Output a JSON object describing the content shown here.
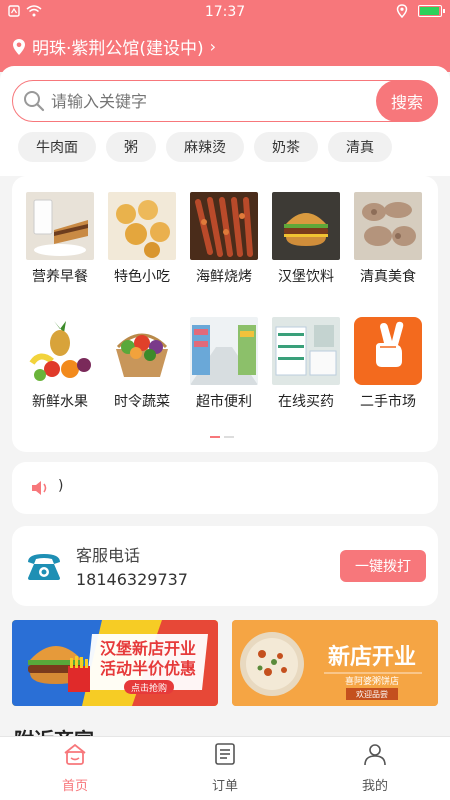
{
  "status_bar": {
    "time": "17:37",
    "battery_level": 0.85,
    "icons": [
      "sim-icon",
      "wifi-icon",
      "location-icon",
      "battery-icon"
    ]
  },
  "header": {
    "location": "明珠·紫荆公馆(建设中)",
    "chevron": "›"
  },
  "search": {
    "placeholder": "请输入关键字",
    "button": "搜索"
  },
  "tags": [
    "牛肉面",
    "粥",
    "麻辣烫",
    "奶茶",
    "清真"
  ],
  "categories": [
    {
      "label": "营养早餐",
      "icon": "breakfast-image"
    },
    {
      "label": "特色小吃",
      "icon": "snacks-image"
    },
    {
      "label": "海鲜烧烤",
      "icon": "bbq-image"
    },
    {
      "label": "汉堡饮料",
      "icon": "burger-image"
    },
    {
      "label": "清真美食",
      "icon": "halal-image"
    },
    {
      "label": "新鲜水果",
      "icon": "fruit-image"
    },
    {
      "label": "时令蔬菜",
      "icon": "vegetable-image"
    },
    {
      "label": "超市便利",
      "icon": "supermarket-image"
    },
    {
      "label": "在线买药",
      "icon": "pharmacy-image"
    },
    {
      "label": "二手市场",
      "icon": "secondhand-image"
    }
  ],
  "secondhand_logo_text": "二手市场",
  "notice": {
    "text": ")"
  },
  "service": {
    "title": "客服电话",
    "phone": "18146329737",
    "button": "一键拨打"
  },
  "banners": [
    {
      "line1": "汉堡新店开业",
      "line2": "活动半价优惠",
      "button": "点击抢购"
    },
    {
      "title": "新店开业",
      "shop": "喜阿婆粥饼店",
      "sub": "欢迎品尝"
    }
  ],
  "section_title": "附近商家",
  "tabs": [
    {
      "label": "首页",
      "icon": "home-icon",
      "active": true
    },
    {
      "label": "订单",
      "icon": "orders-icon",
      "active": false
    },
    {
      "label": "我的",
      "icon": "profile-icon",
      "active": false
    }
  ],
  "colors": {
    "accent": "#f7777b",
    "background": "#f4f4f4"
  }
}
